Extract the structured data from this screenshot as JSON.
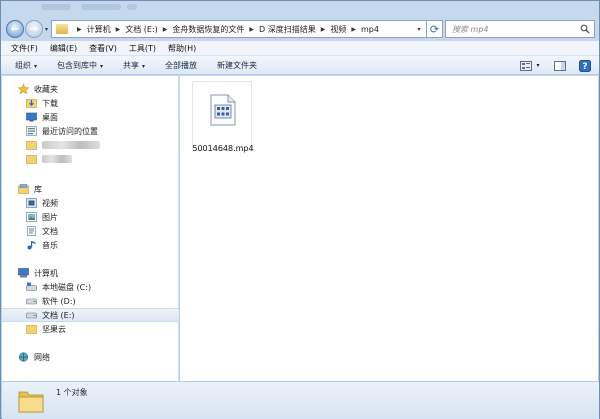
{
  "search": {
    "placeholder": "搜索 mp4"
  },
  "address": {
    "crumbs": [
      "计算机",
      "文档 (E:)",
      "金舟数据恢复的文件",
      "D 深度扫描结果",
      "视频",
      "mp4"
    ]
  },
  "menu": {
    "items": [
      "文件(F)",
      "编辑(E)",
      "查看(V)",
      "工具(T)",
      "帮助(H)"
    ]
  },
  "toolbar": {
    "organize": "组织",
    "include_library": "包含到库中",
    "share": "共享",
    "play_all": "全部播放",
    "new_folder": "新建文件夹"
  },
  "nav": {
    "favorites": {
      "header": "收藏夹",
      "items": [
        "下载",
        "桌面",
        "最近访问的位置"
      ]
    },
    "libraries": {
      "header": "库",
      "items": [
        "视频",
        "图片",
        "文档",
        "音乐"
      ]
    },
    "computer": {
      "header": "计算机",
      "items": [
        "本地磁盘 (C:)",
        "软件 (D:)",
        "文档 (E:)",
        "坚果云"
      ]
    },
    "network": {
      "header": "网络"
    }
  },
  "files": [
    {
      "name": "50014648.mp4"
    }
  ],
  "details": {
    "count": "1 个对象"
  },
  "colors": {
    "chrome": "#b9d1ea",
    "selection": "#dde7f4",
    "accent": "#2a6ab5"
  }
}
